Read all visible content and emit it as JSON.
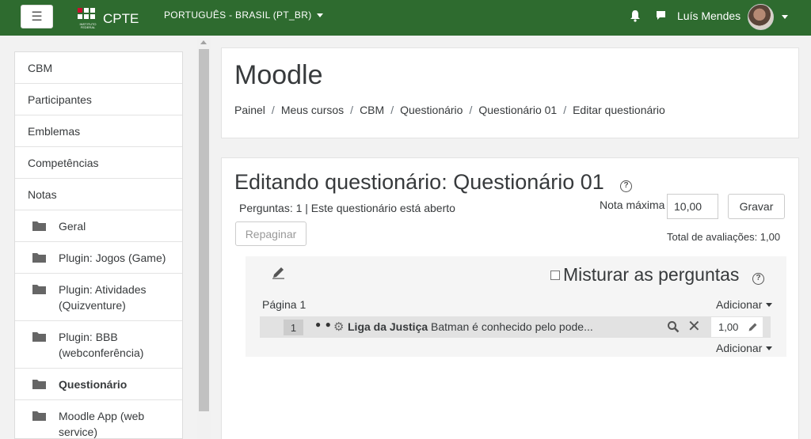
{
  "navbar": {
    "menu_icon": "hamburger-icon",
    "logo_text": "INSTITUTO FEDERAL",
    "brand": "CPTE",
    "language": "PORTUGUÊS - BRASIL (PT_BR)",
    "notification_icon": "bell-icon",
    "messages_icon": "chat-icon",
    "user_name": "Luís Mendes",
    "color": "#2e6b2f"
  },
  "sidebar": {
    "items": [
      {
        "label": "CBM"
      },
      {
        "label": "Participantes"
      },
      {
        "label": "Emblemas"
      },
      {
        "label": "Competências"
      },
      {
        "label": "Notas"
      },
      {
        "label": "Geral"
      },
      {
        "label": "Plugin: Jogos (Game)"
      },
      {
        "label": "Plugin: Atividades (Quizventure)"
      },
      {
        "label": "Plugin: BBB (webconferência)"
      },
      {
        "label": "Questionário"
      },
      {
        "label": "Moodle App (web service)"
      }
    ]
  },
  "header": {
    "title": "Moodle",
    "breadcrumb": [
      "Painel",
      "Meus cursos",
      "CBM",
      "Questionário",
      "Questionário 01",
      "Editar questionário"
    ]
  },
  "main": {
    "title": "Editando questionário: Questionário 01",
    "status": "Perguntas: 1 | Este questionário está aberto",
    "repaginate_label": "Repaginar",
    "max_grade_label": "Nota máxima",
    "max_grade_value": "10,00",
    "save_label": "Gravar",
    "total_label": "Total de avaliações: 1,00",
    "shuffle_label": "Misturar as perguntas",
    "page_label": "Página 1",
    "add_label": "Adicionar",
    "question": {
      "number": "1",
      "name": "Liga da Justiça",
      "text": "Batman é conhecido pelo pode...",
      "mark": "1,00"
    }
  }
}
